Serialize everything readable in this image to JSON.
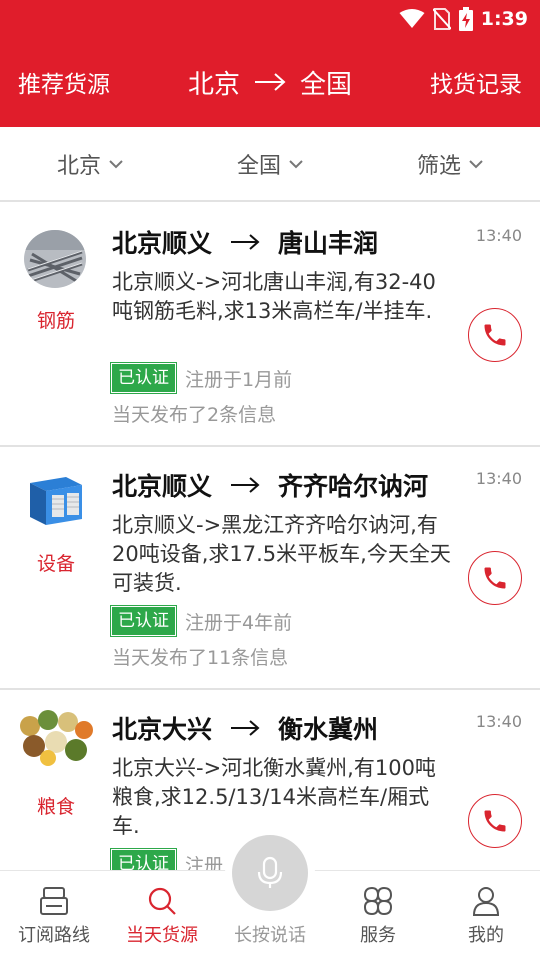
{
  "status_bar": {
    "time": "1:39"
  },
  "header": {
    "left_label": "推荐货源",
    "route_from": "北京",
    "route_to": "全国",
    "right_label": "找货记录"
  },
  "filters": [
    {
      "label": "北京"
    },
    {
      "label": "全国"
    },
    {
      "label": "筛选"
    }
  ],
  "listings": [
    {
      "category": "钢筋",
      "thumbnail": "steel-rebar-image",
      "from": "北京顺义",
      "to": "唐山丰润",
      "time": "13:40",
      "description": "北京顺义->河北唐山丰润,有32-40吨钢筋毛料,求13米高栏车/半挂车.",
      "verified": "已认证",
      "registered": "注册于1月前",
      "posted": "当天发布了2条信息"
    },
    {
      "category": "设备",
      "thumbnail": "equipment-image",
      "from": "北京顺义",
      "to": "齐齐哈尔讷河",
      "time": "13:40",
      "description": "北京顺义->黑龙江齐齐哈尔讷河,有20吨设备,求17.5米平板车,今天全天可装货.",
      "verified": "已认证",
      "registered": "注册于4年前",
      "posted": "当天发布了11条信息"
    },
    {
      "category": "粮食",
      "thumbnail": "grain-image",
      "from": "北京大兴",
      "to": "衡水冀州",
      "time": "13:40",
      "description": "北京大兴->河北衡水冀州,有100吨粮食,求12.5/13/14米高栏车/厢式车.",
      "verified": "已认证",
      "registered": "注册",
      "posted": ""
    }
  ],
  "tabs": [
    {
      "label": "订阅路线",
      "icon": "subscribe-route-icon"
    },
    {
      "label": "当天货源",
      "icon": "search-icon"
    },
    {
      "label": "长按说话",
      "icon": "microphone-icon"
    },
    {
      "label": "服务",
      "icon": "service-grid-icon"
    },
    {
      "label": "我的",
      "icon": "user-icon"
    }
  ],
  "colors": {
    "brand_red": "#e01d2b",
    "verified_green": "#2da84a"
  }
}
